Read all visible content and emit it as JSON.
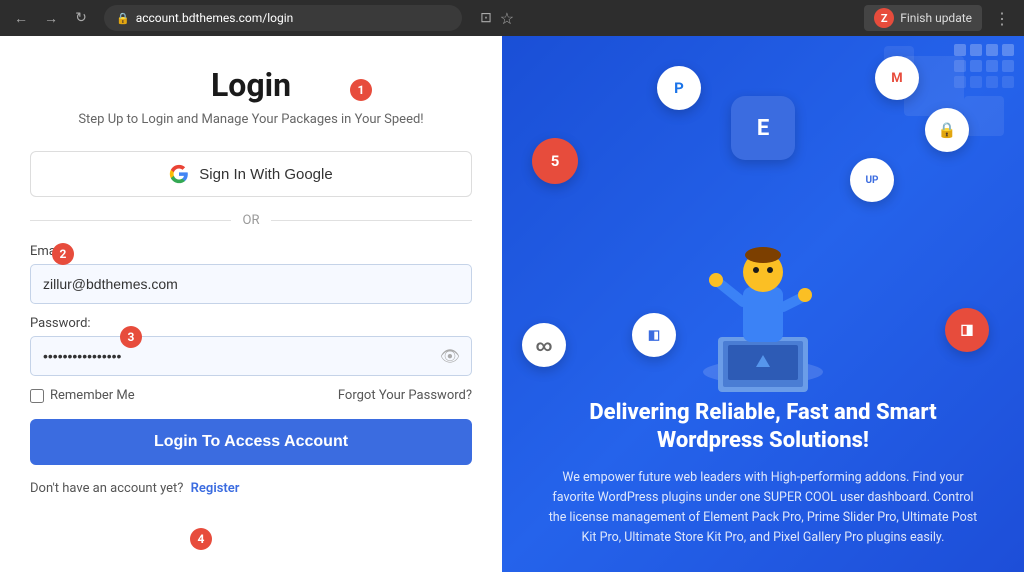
{
  "browser": {
    "url": "account.bdthemes.com/login",
    "back_icon": "←",
    "forward_icon": "→",
    "reload_icon": "↻",
    "lock_icon": "🔒",
    "star_icon": "☆",
    "cast_icon": "⊡",
    "menu_icon": "⋮",
    "avatar_letter": "Z",
    "finish_update_label": "Finish update"
  },
  "login": {
    "title": "Login",
    "subtitle": "Step Up to Login and Manage Your Packages in Your Speed!",
    "google_btn_label": "Sign In With Google",
    "or_label": "OR",
    "email_label": "Email:",
    "email_value": "zillur@bdthemes.com",
    "password_label": "Password:",
    "password_value": "••••••••••••••••",
    "remember_me_label": "Remember Me",
    "forgot_password_label": "Forgot Your Password?",
    "login_btn_label": "Login To Access Account",
    "register_text": "Don't have an account yet?",
    "register_link_label": "Register"
  },
  "right_panel": {
    "title": "Delivering Reliable, Fast and Smart Wordpress Solutions!",
    "description": "We empower future web leaders with High-performing addons. Find your favorite WordPress plugins under one SUPER COOL user dashboard. Control the license management of Element Pack Pro, Prime Slider Pro, Ultimate Post Kit Pro, Ultimate Store Kit Pro, and Pixel Gallery Pro plugins easily.",
    "plugins": [
      {
        "letter": "P",
        "color": "#e8e8e8",
        "style": "top:30px;left:160px"
      },
      {
        "letter": "M",
        "color": "#e8e8e8",
        "style": "top:20px;right:80px"
      },
      {
        "letter": "5",
        "color": "#e74c3c",
        "style": "top:100px;left:40px"
      },
      {
        "letter": "E",
        "color": "#3b6ce0",
        "style": "top:60px;left:220px",
        "large": true
      },
      {
        "letter": "🔒",
        "color": "#f5a623",
        "style": "top:80px;right:60px"
      },
      {
        "letter": "∞",
        "color": "#e8e8e8",
        "style": "top:170px;left:30px"
      },
      {
        "letter": "◧",
        "color": "#e8e8e8",
        "style": "top:150px;left:140px"
      },
      {
        "letter": "◨",
        "color": "#e74c3c",
        "style": "top:130px;right:40px"
      },
      {
        "letter": "UP",
        "color": "#3b6ce0",
        "style": "top:110px;right:130px",
        "small_text": true
      }
    ]
  },
  "annotations": {
    "1": "1",
    "2": "2",
    "3": "3",
    "4": "4"
  },
  "colors": {
    "accent_blue": "#3b6ce0",
    "red": "#e74c3c",
    "right_panel_bg": "#1d4ed8"
  }
}
